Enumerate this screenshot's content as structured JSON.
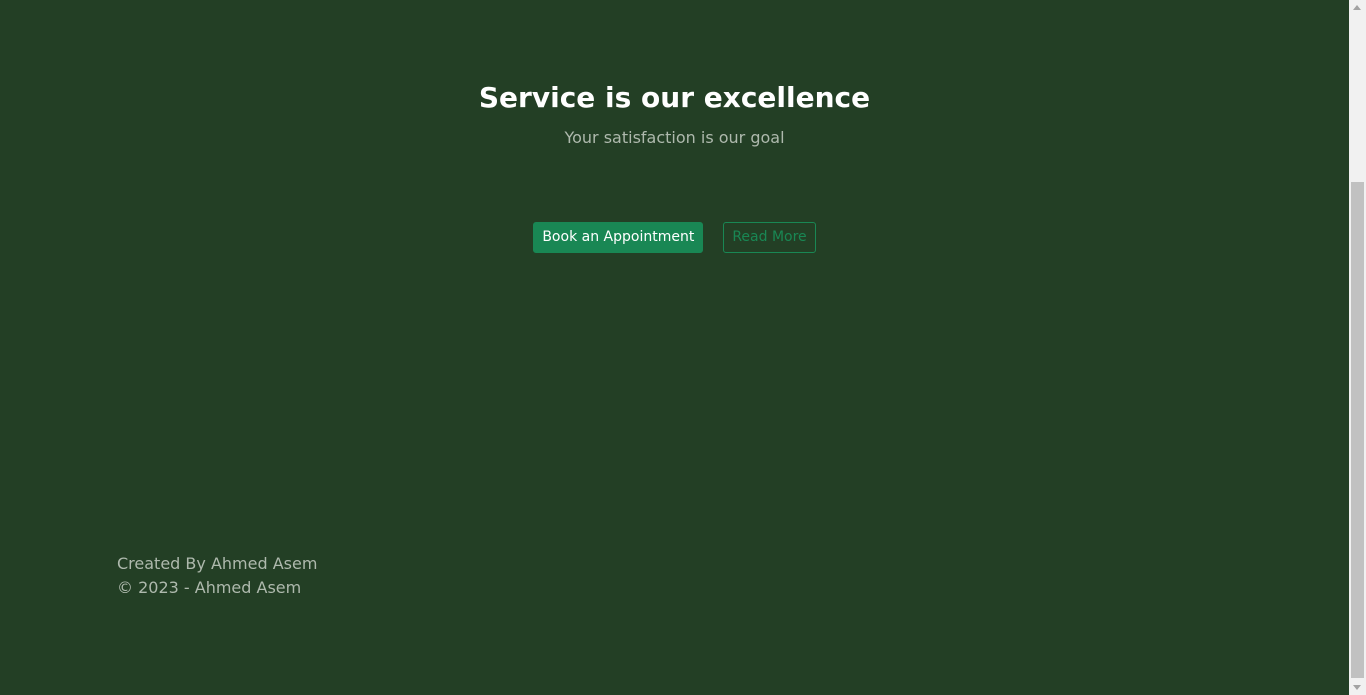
{
  "hero": {
    "title": "Service is our excellence",
    "subtitle": "Your satisfaction is our goal"
  },
  "actions": {
    "primary_label": "Book an Appointment",
    "secondary_label": "Read More"
  },
  "footer": {
    "credit": "Created By Ahmed Asem",
    "copyright": "© 2023 - Ahmed Asem"
  },
  "colors": {
    "background": "#233f25",
    "accent": "#198754",
    "muted_text": "#aeb9ad"
  }
}
